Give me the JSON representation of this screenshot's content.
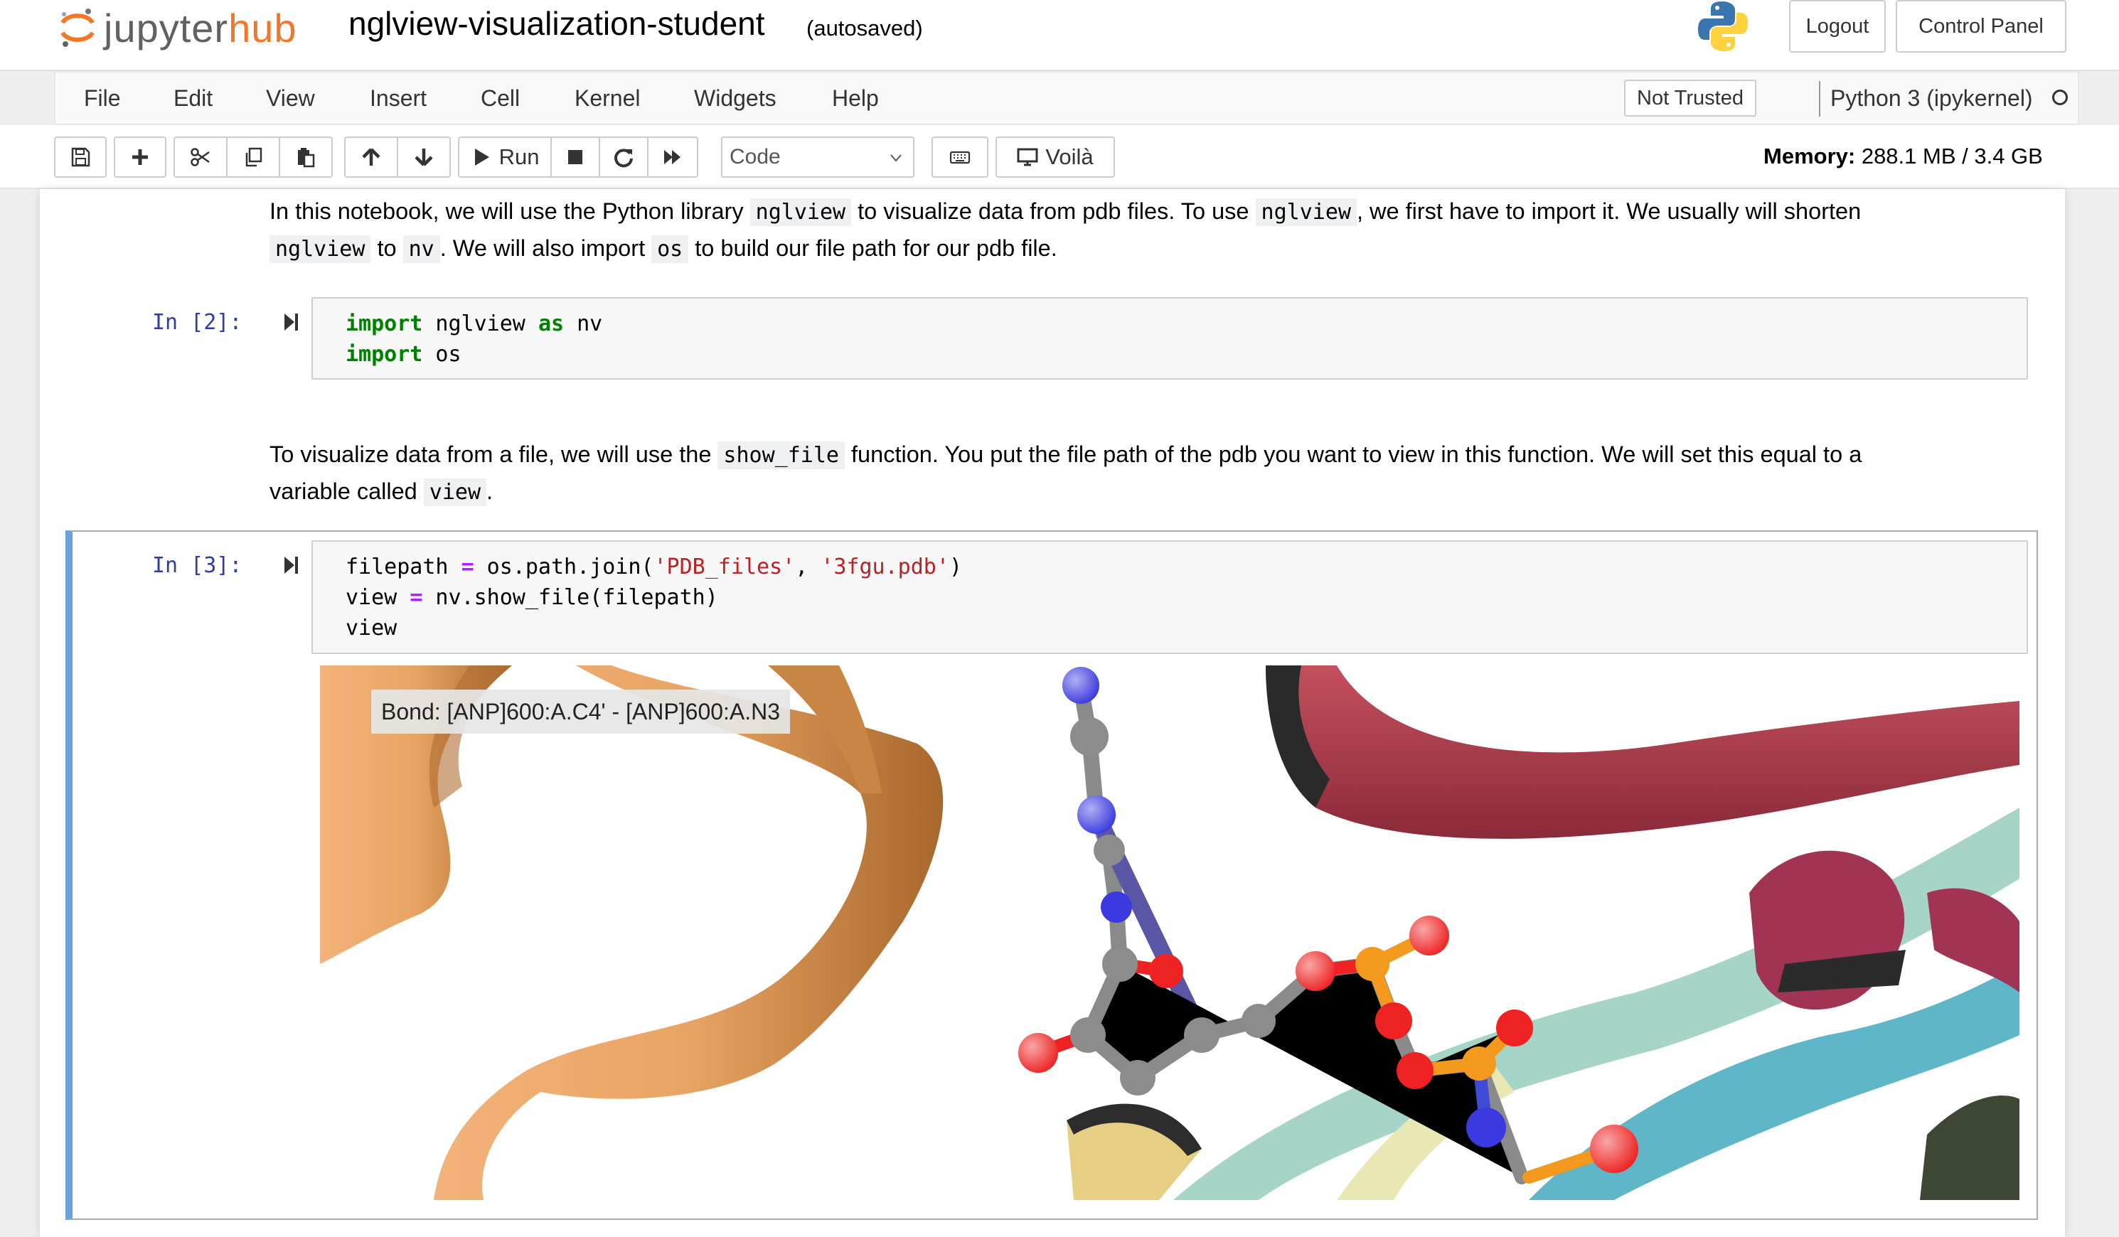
{
  "header": {
    "brand_jupyter": "jupyter",
    "brand_hub": "hub",
    "notebook_title": "nglview-visualization-student",
    "autosave_status": "(autosaved)",
    "logout_label": "Logout",
    "control_panel_label": "Control Panel"
  },
  "menubar": {
    "items": [
      "File",
      "Edit",
      "View",
      "Insert",
      "Cell",
      "Kernel",
      "Widgets",
      "Help"
    ],
    "trust_status": "Not Trusted",
    "kernel_name": "Python 3 (ipykernel)"
  },
  "toolbar": {
    "run_label": "Run",
    "cell_type": "Code",
    "voila_label": "Voilà",
    "memory_label": "Memory:",
    "memory_value": "288.1 MB / 3.4 GB"
  },
  "cells": {
    "md1": {
      "t1": "In this notebook, we will use the Python library ",
      "c1": "nglview",
      "t2": " to visualize data from pdb files. To use ",
      "c2": "nglview",
      "t3": ", we first have to import it. We usually will shorten",
      "c3": "nglview",
      "t4": " to ",
      "c4": "nv",
      "t5": ". We will also import ",
      "c5": "os",
      "t6": " to build our file path for our pdb file."
    },
    "code2": {
      "prompt": "In [2]:",
      "kw1": "import",
      "mod1": " nglview ",
      "as": "as",
      "alias": " nv",
      "kw2": "import",
      "mod2": " os"
    },
    "md2": {
      "t1": "To visualize data from a file, we will use the ",
      "c1": "show_file",
      "t2": " function. You put the file path of the pdb you want to view in this function. We will set this equal to a",
      "t3": "variable called ",
      "c2": "view",
      "t4": "."
    },
    "code3": {
      "prompt": "In [3]:",
      "l1a": "filepath ",
      "eq1": "=",
      "l1b": " os.path.join(",
      "s1": "'PDB_files'",
      "l1c": ", ",
      "s2": "'3fgu.pdb'",
      "l1d": ")",
      "l2a": "view ",
      "eq2": "=",
      "l2b": " nv.show_file(filepath)",
      "l3": "view"
    },
    "viewer": {
      "tooltip": "Bond: [ANP]600:A.C4' - [ANP]600:A.N3"
    }
  },
  "colors": {
    "accent_orange": "#f37726",
    "prompt_blue": "#303f9f",
    "selected_cell_border": "#66a3e0",
    "keyword_green": "#008000",
    "string_red": "#ba2121",
    "operator_purple": "#aa22ff"
  },
  "icons": [
    "save-icon",
    "plus-icon",
    "cut-icon",
    "copy-icon",
    "paste-icon",
    "arrow-up-icon",
    "arrow-down-icon",
    "play-icon",
    "stop-icon",
    "restart-icon",
    "fast-forward-icon",
    "keyboard-icon",
    "monitor-icon",
    "python-logo-icon",
    "jupyter-logo-icon"
  ]
}
